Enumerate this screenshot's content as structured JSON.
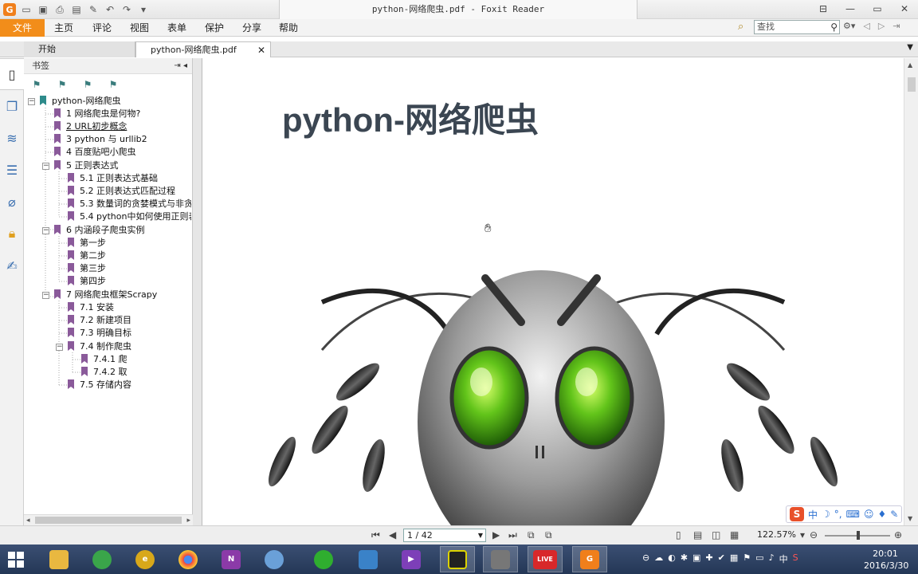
{
  "window": {
    "title": "python-网络爬虫.pdf - Foxit Reader",
    "controls": [
      "⊟",
      "⊞",
      "▭",
      "✕"
    ]
  },
  "menu": {
    "items": [
      "文件",
      "主页",
      "评论",
      "视图",
      "表单",
      "保护",
      "分享",
      "帮助"
    ],
    "search_placeholder": "查找"
  },
  "tabs": {
    "start": "开始",
    "doc": "python-网络爬虫.pdf"
  },
  "bookmarks": {
    "header": "书签",
    "root": "python-网络爬虫",
    "items": [
      "1 网络爬虫是何物?",
      "2 URL初步概念",
      "3 python 与 urllib2",
      "4 百度贴吧小爬虫",
      "5 正则表达式",
      "5.1 正则表达式基础",
      "5.2 正则表达式匹配过程",
      "5.3 数量词的贪婪模式与非贪",
      "5.4 python中如何使用正则表",
      "6 内涵段子爬虫实例",
      "第一步",
      "第二步",
      "第三步",
      "第四步",
      "7 网络爬虫框架Scrapy",
      "7.1 安装",
      "7.2 新建项目",
      "7.3 明确目标",
      "7.4 制作爬虫",
      "7.4.1 爬",
      "7.4.2 取",
      "7.5 存储内容"
    ]
  },
  "document": {
    "heading": "python-网络爬虫"
  },
  "status": {
    "page": "1 / 42",
    "zoom": "122.57%"
  },
  "taskbar": {
    "time": "20:01",
    "date": "2016/3/30",
    "ime_label": "中",
    "live_label": "LIVE"
  }
}
